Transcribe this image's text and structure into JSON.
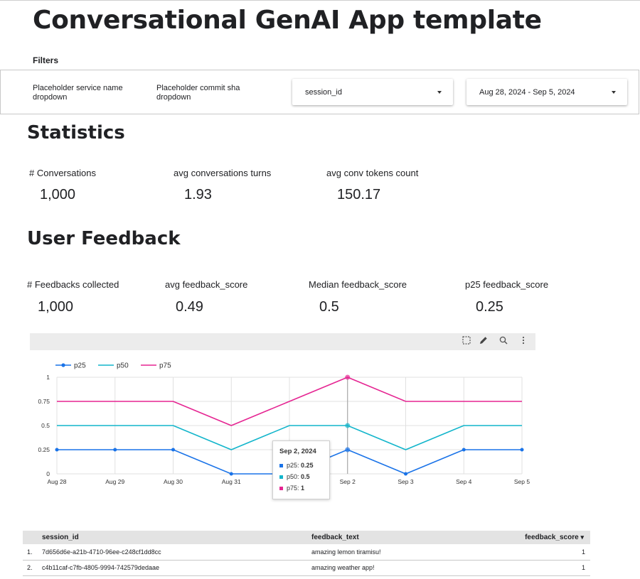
{
  "app": {
    "title": "Conversational GenAI App template"
  },
  "filters": {
    "label": "Filters",
    "service_placeholder": "Placeholder service name dropdown",
    "commit_placeholder": "Placeholder commit sha dropdown",
    "session_dropdown": "session_id",
    "date_range": "Aug 28, 2024 - Sep 5, 2024"
  },
  "statistics": {
    "heading": "Statistics",
    "kpis": [
      {
        "label": "# Conversations",
        "value": "1,000"
      },
      {
        "label": "avg conversations turns",
        "value": "1.93"
      },
      {
        "label": "avg conv tokens count",
        "value": "150.17"
      }
    ]
  },
  "feedback": {
    "heading": "User Feedback",
    "kpis": [
      {
        "label": "# Feedbacks collected",
        "value": "1,000"
      },
      {
        "label": "avg feedback_score",
        "value": "0.49"
      },
      {
        "label": "Median feedback_score",
        "value": "0.5"
      },
      {
        "label": "p25 feedback_score",
        "value": "0.25"
      }
    ]
  },
  "toolbar": {
    "icons": [
      "select-icon",
      "edit-icon",
      "zoom-icon",
      "more-icon"
    ]
  },
  "chart_data": {
    "type": "line",
    "categories": [
      "Aug 28",
      "Aug 29",
      "Aug 30",
      "Aug 31",
      "Sep 1",
      "Sep 2",
      "Sep 3",
      "Sep 4",
      "Sep 5"
    ],
    "x_tick_labels": [
      "Aug 28",
      "Aug 29",
      "Aug 30",
      "Aug 31",
      "Sep 2",
      "Sep 3",
      "Sep 4",
      "Sep 5"
    ],
    "y_ticks": [
      "0",
      "0.25",
      "0.5",
      "0.75",
      "1"
    ],
    "ylim": [
      0,
      1
    ],
    "grid": true,
    "legend": "top-left",
    "series": [
      {
        "name": "p25",
        "color": "#1a73e8",
        "values": [
          0.25,
          0.25,
          0.25,
          0,
          0,
          0.25,
          0,
          0.25,
          0.25
        ]
      },
      {
        "name": "p50",
        "color": "#12b5cb",
        "values": [
          0.5,
          0.5,
          0.5,
          0.25,
          0.5,
          0.5,
          0.25,
          0.5,
          0.5
        ]
      },
      {
        "name": "p75",
        "color": "#e52592",
        "values": [
          0.75,
          0.75,
          0.75,
          0.5,
          0.75,
          1,
          0.75,
          0.75,
          0.75
        ]
      }
    ],
    "tooltip": {
      "title": "Sep 2, 2024",
      "rows": [
        {
          "name": "p25: ",
          "value": "0.25"
        },
        {
          "name": "p50: ",
          "value": "0.5"
        },
        {
          "name": "p75: ",
          "value": "1"
        }
      ]
    }
  },
  "table": {
    "headers": [
      "session_id",
      "feedback_text",
      "feedback_score"
    ],
    "sort_indicator": "▾",
    "rows": [
      {
        "index": "1.",
        "session_id": "7d656d6e-a21b-4710-96ee-c248cf1dd8cc",
        "feedback_text": "amazing lemon tiramisu!",
        "feedback_score": "1"
      },
      {
        "index": "2.",
        "session_id": "c4b11caf-c7fb-4805-9994-742579dedaae",
        "feedback_text": "amazing weather app!",
        "feedback_score": "1"
      }
    ]
  }
}
